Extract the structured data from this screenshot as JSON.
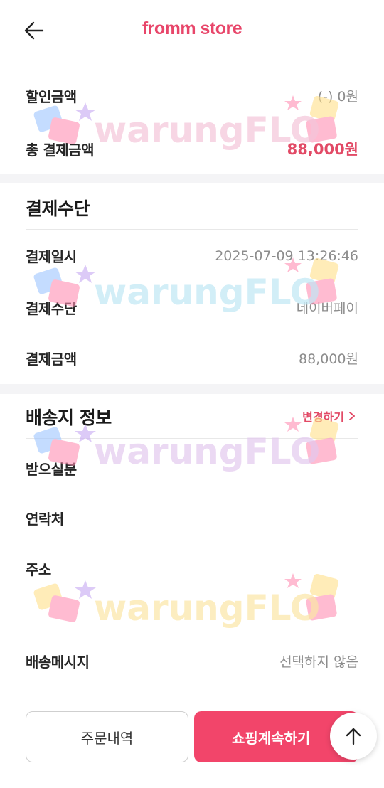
{
  "header": {
    "logo": "fromm store",
    "back_icon": "arrow-left-icon"
  },
  "summary": {
    "discount_label": "할인금액",
    "discount_value": "(-) 0원",
    "total_label": "총 결제금액",
    "total_value": "88,000원"
  },
  "payment": {
    "title": "결제수단",
    "date_label": "결제일시",
    "date_value": "2025-07-09 13:26:46",
    "method_label": "결제수단",
    "method_value": "네이버페이",
    "amount_label": "결제금액",
    "amount_value": "88,000원"
  },
  "shipping": {
    "title": "배송지 정보",
    "change_label": "변경하기",
    "recipient_label": "받으실분",
    "contact_label": "연락처",
    "address_label": "주소",
    "message_label": "배송메시지",
    "message_value": "선택하지 않음"
  },
  "actions": {
    "order_history": "주문내역",
    "continue_shopping": "쇼핑계속하기"
  },
  "watermark": {
    "text": "warungFLO"
  },
  "colors": {
    "accent": "#e24a66",
    "button": "#f2456a"
  }
}
